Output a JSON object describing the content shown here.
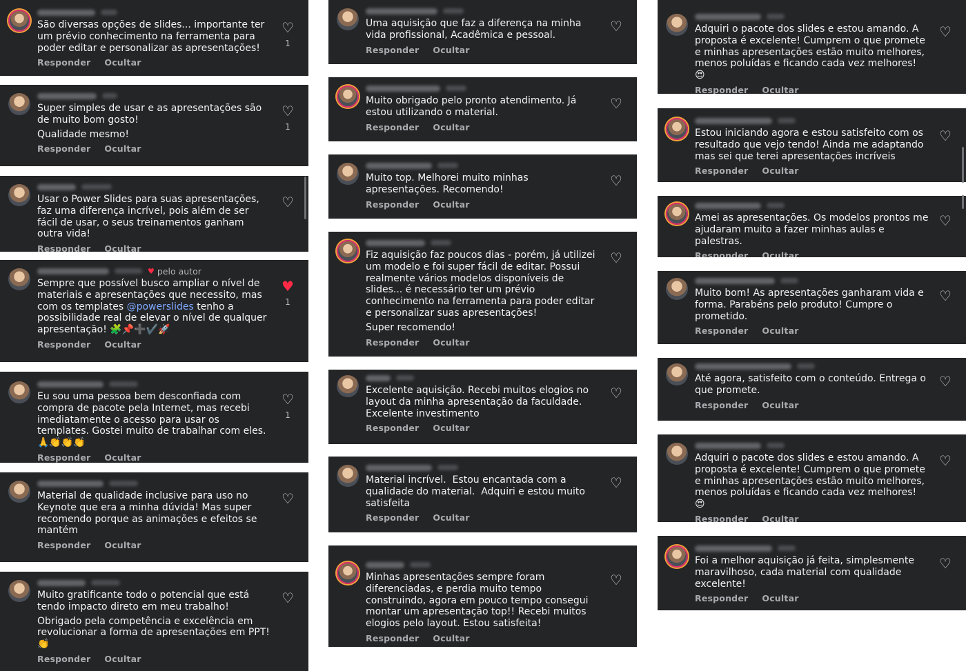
{
  "actions": {
    "reply": "Responder",
    "hide": "Ocultar"
  },
  "author_tag": "pelo autor",
  "columns": [
    {
      "comments": [
        {
          "lines": [
            "São diversas opções de slides... importante ter um prévio conhecimento na ferramenta para poder editar e personalizar as apresentações!"
          ],
          "likes": "1",
          "liked": false
        },
        {
          "lines": [
            "Super simples de usar e as apresentações são de muito bom gosto!",
            "Qualidade mesmo!"
          ],
          "likes": "1",
          "liked": false
        },
        {
          "lines": [
            "Usar o Power Slides para suas apresentações, faz uma diferença incrível, pois além de ser fácil de usar, o seus treinamentos ganham outra vida!"
          ],
          "likes": "",
          "liked": false
        },
        {
          "pre": "Sempre que possível busco ampliar o nível de materiais e apresentações que necessito, mas com os templates ",
          "mention": "@powerslides",
          "post": " tenho a possibilidade real de elevar o nível de qualquer apresentação! 🧩📌➕✔️🚀",
          "likes": "1",
          "liked": true,
          "by_author": true
        },
        {
          "lines": [
            "Eu sou uma pessoa bem desconfiada com compra de pacote pela Internet, mas recebi imediatamente o acesso para usar os templates. Gostei muito de trabalhar com eles. 🙏👏👏👏"
          ],
          "likes": "1",
          "liked": false
        },
        {
          "lines": [
            "Material de qualidade inclusive para uso no Keynote que era a minha dúvida! Mas super recomendo porque as animações e efeitos se mantém"
          ],
          "likes": "",
          "liked": false
        },
        {
          "lines": [
            "Muito gratificante todo o potencial que está tendo impacto direto em meu trabalho!",
            "Obrigado pela competência e excelência em revolucionar a forma de apresentações em PPT! 👏"
          ],
          "likes": "",
          "liked": false
        }
      ]
    },
    {
      "comments": [
        {
          "lines": [
            "Uma aquisição que faz a diferença na minha vida profissional, Acadêmica e pessoal."
          ],
          "likes": "",
          "liked": false
        },
        {
          "lines": [
            "Muito obrigado pelo pronto atendimento. Já estou utilizando o material."
          ],
          "likes": "",
          "liked": false
        },
        {
          "lines": [
            "Muito top. Melhorei muito minhas apresentações. Recomendo!"
          ],
          "likes": "",
          "liked": false
        },
        {
          "lines": [
            "Fiz aquisição faz poucos dias - porém, já utilizei um modelo e foi super fácil de editar. Possui realmente vários modelos disponíveis de slides... é necessário ter um prévio conhecimento na ferramenta para poder editar e personalizar suas apresentações!",
            "Super recomendo!"
          ],
          "likes": "",
          "liked": false
        },
        {
          "lines": [
            "Excelente aquisição. Recebi muitos elogios no layout da minha apresentação da faculdade. Excelente investimento"
          ],
          "likes": "",
          "liked": false
        },
        {
          "lines": [
            "Material incrível.  Estou encantada com a qualidade do material.  Adquiri e estou muito satisfeita"
          ],
          "likes": "",
          "liked": false
        },
        {
          "lines": [
            "Minhas apresentações sempre foram diferenciadas, e perdia muito tempo construindo, agora em pouco tempo consegui montar um apresentação top!! Recebi muitos elogios pelo layout. Estou satisfeita!"
          ],
          "likes": "",
          "liked": false
        }
      ]
    },
    {
      "comments": [
        {
          "lines": [
            "Adquiri o pacote dos slides e estou amando. A proposta é excelente! Cumprem o que promete e minhas apresentações estão muito melhores, menos poluídas e ficando cada vez melhores! 😍"
          ],
          "likes": "",
          "liked": false
        },
        {
          "lines": [
            "Estou iniciando agora e estou satisfeito com os resultado que vejo tendo! Ainda me adaptando mas sei que terei apresentações incríveis"
          ],
          "likes": "",
          "liked": false
        },
        {
          "lines": [
            "Amei as apresentações. Os modelos prontos me ajudaram muito a fazer minhas aulas e palestras."
          ],
          "likes": "",
          "liked": false
        },
        {
          "lines": [
            "Muito bom! As apresentações ganharam vida e forma. Parabéns pelo produto! Cumpre o prometido."
          ],
          "likes": "",
          "liked": false
        },
        {
          "lines": [
            "Até agora, satisfeito com o conteúdo. Entrega o que promete."
          ],
          "likes": "",
          "liked": false
        },
        {
          "lines": [
            "Adquiri o pacote dos slides e estou amando. A proposta é excelente! Cumprem o que promete e minhas apresentações estão muito melhores, menos poluídas e ficando cada vez melhores! 😍"
          ],
          "likes": "",
          "liked": false
        },
        {
          "lines": [
            "Foi a melhor aquisição já feita, simplesmente maravilhoso, cada material com qualidade excelente!"
          ],
          "likes": "",
          "liked": false
        }
      ]
    }
  ]
}
